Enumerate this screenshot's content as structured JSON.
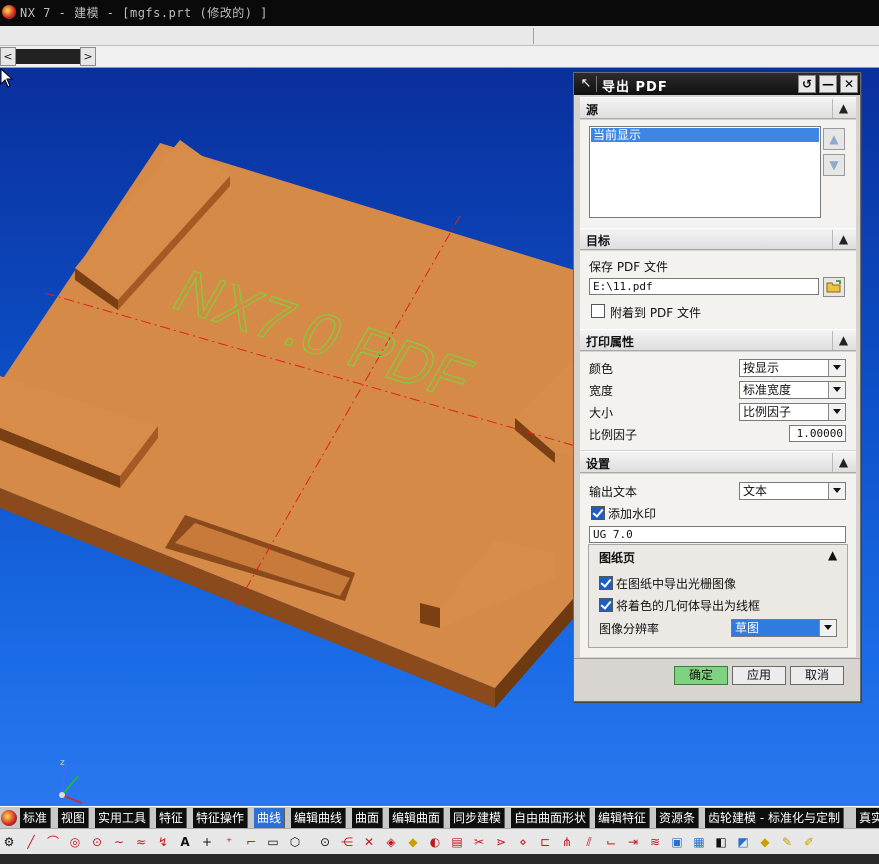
{
  "window": {
    "title": "NX 7 - 建模 - [mgfs.prt (修改的) ]"
  },
  "scrollbar": {
    "left_arrow": "<",
    "right_arrow": ">"
  },
  "viewport": {
    "watermark": "NX7.0 PDF",
    "triad_axis_label": "z"
  },
  "dialog": {
    "title": "导出 PDF",
    "title_buttons": {
      "reset": "↺",
      "minimize": "—",
      "close": "✕"
    },
    "sections": {
      "source": {
        "header": "源",
        "list_items": [
          "当前显示"
        ],
        "move_up": "▲",
        "move_down": "▼"
      },
      "destination": {
        "header": "目标",
        "save_label": "保存 PDF 文件",
        "file_path": "E:\\11.pdf",
        "append_label": "附着到 PDF 文件",
        "append_checked": false
      },
      "print": {
        "header": "打印属性",
        "color_label": "颜色",
        "color_value": "按显示",
        "width_label": "宽度",
        "width_value": "标准宽度",
        "size_label": "大小",
        "size_value": "比例因子",
        "scale_label": "比例因子",
        "scale_value": "1.00000"
      },
      "settings": {
        "header": "设置",
        "output_text_label": "输出文本",
        "output_text_value": "文本",
        "watermark_label": "添加水印",
        "watermark_checked": true,
        "watermark_text": "UG 7.0",
        "drawing": {
          "header": "图纸页",
          "raster_label": "在图纸中导出光栅图像",
          "raster_checked": true,
          "wireframe_label": "将着色的几何体导出为线框",
          "wireframe_checked": true,
          "resolution_label": "图像分辨率",
          "resolution_value": "草图"
        }
      }
    },
    "buttons": {
      "ok": "确定",
      "apply": "应用",
      "cancel": "取消"
    }
  },
  "tabs": [
    "标准",
    "视图",
    "实用工具",
    "特征",
    "特征操作",
    "曲线",
    "编辑曲线",
    "曲面",
    "编辑曲面",
    "同步建模",
    "自由曲面形状",
    "编辑特征",
    "资源条",
    "齿轮建模 - 标准化与定制",
    "真实"
  ],
  "active_tab": "曲线",
  "toolbar_icons": [
    "gear-icon",
    "line-icon",
    "arc-icon",
    "circle-icon",
    "point-icon",
    "spline-icon",
    "helix-icon",
    "text-icon",
    "cross-icon",
    "point-set-icon",
    "fillet-icon",
    "rectangle-icon",
    "polygon-icon",
    "ellipse-icon",
    "law-curve-icon",
    "offset-curve-icon",
    "bridge-icon",
    "project-icon",
    "intersect-icon",
    "section-icon",
    "extract-icon",
    "isoparametric-icon",
    "composite-icon",
    "join-icon",
    "split-icon",
    "trim-icon",
    "corner-icon",
    "length-icon",
    "smooth-icon",
    "edit-icon",
    "table-icon",
    "view-icon",
    "render-icon",
    "lamp-icon",
    "light-icon"
  ],
  "colors": {
    "part": "#d68a47",
    "part_side": "#8a4a1c",
    "background_top": "#0a2f9c",
    "background_bottom": "#2a78ef",
    "watermark": "#7fcf3a",
    "active_tab": "#2e6fd6"
  }
}
